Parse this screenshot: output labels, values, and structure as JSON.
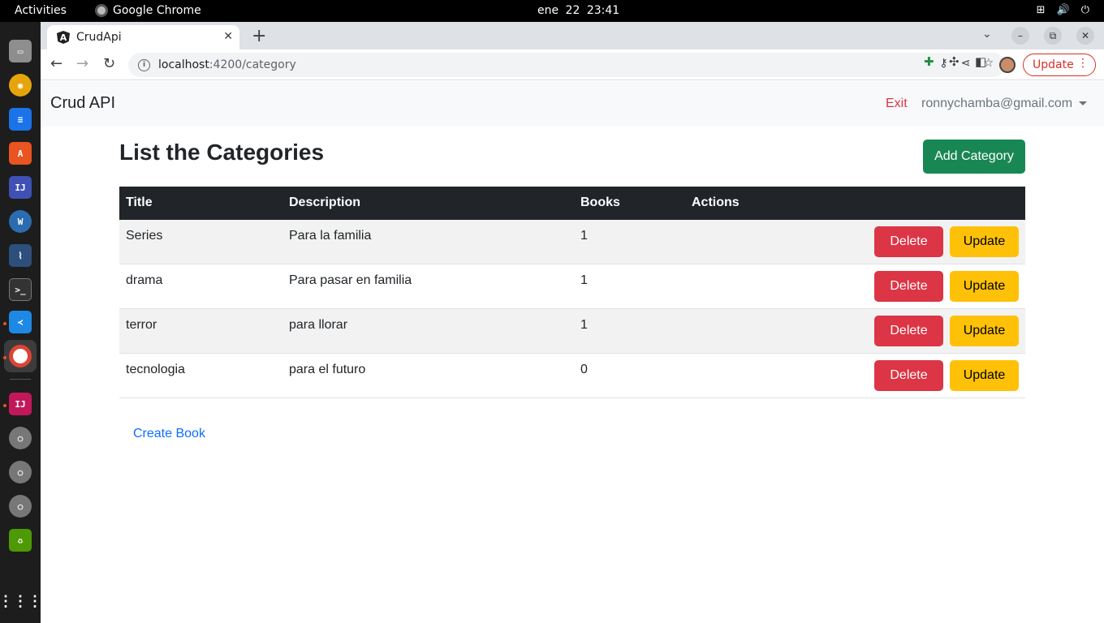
{
  "system_bar": {
    "activities": "Activities",
    "app_name": "Google Chrome",
    "clock": "ene 22  23:41"
  },
  "browser": {
    "tab_title": "CrudApi",
    "tab_favicon": "angular-icon",
    "url_host": "localhost",
    "url_path": ":4200/category",
    "update_label": "Update"
  },
  "app": {
    "brand": "Crud API",
    "exit_label": "Exit",
    "user_email": "ronnychamba@gmail.com",
    "page_title": "List the Categories",
    "add_button": "Add Category",
    "create_book_link": "Create Book",
    "columns": [
      "Title",
      "Description",
      "Books",
      "Actions"
    ],
    "rows": [
      {
        "title": "Series",
        "description": "Para la familia",
        "books": "1",
        "delete": "Delete",
        "update": "Update"
      },
      {
        "title": "drama",
        "description": "Para pasar en familia",
        "books": "1",
        "delete": "Delete",
        "update": "Update"
      },
      {
        "title": "terror",
        "description": "para llorar",
        "books": "1",
        "delete": "Delete",
        "update": "Update"
      },
      {
        "title": "tecnologia",
        "description": "para el futuro",
        "books": "0",
        "delete": "Delete",
        "update": "Update"
      }
    ]
  },
  "colors": {
    "success": "#198754",
    "danger": "#dc3545",
    "warning": "#ffc107",
    "table_head": "#212529",
    "link": "#0d6efd"
  }
}
